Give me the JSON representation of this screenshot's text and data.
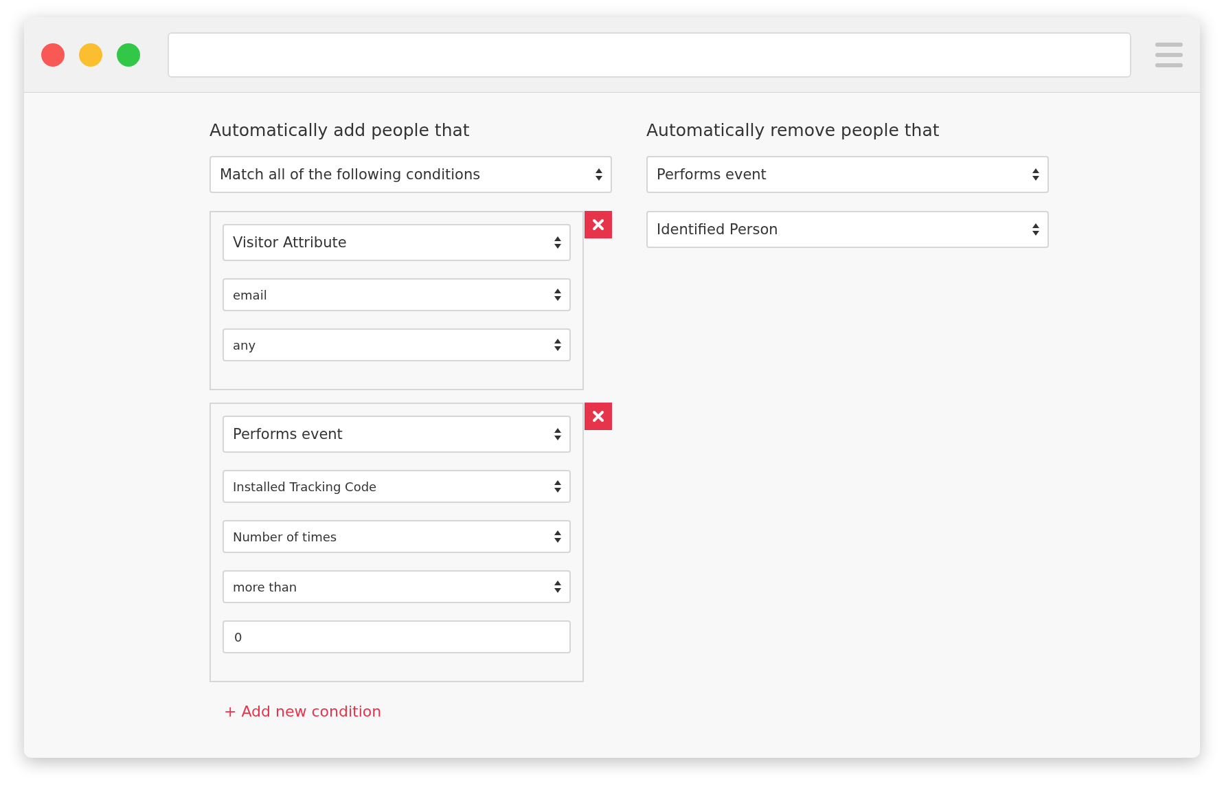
{
  "add_section": {
    "heading": "Automatically add people that",
    "match_select": {
      "value": "Match all of the following conditions"
    },
    "conditions": [
      {
        "fields": [
          {
            "kind": "type-select",
            "value": "Visitor Attribute"
          },
          {
            "kind": "select",
            "value": "email"
          },
          {
            "kind": "select",
            "value": "any"
          }
        ]
      },
      {
        "fields": [
          {
            "kind": "type-select",
            "value": "Performs event"
          },
          {
            "kind": "select",
            "value": "Installed Tracking Code"
          },
          {
            "kind": "select",
            "value": "Number of times"
          },
          {
            "kind": "select",
            "value": "more than"
          },
          {
            "kind": "input",
            "value": "0"
          }
        ]
      }
    ],
    "add_link": "+ Add new condition"
  },
  "remove_section": {
    "heading": "Automatically remove people that",
    "selects": [
      {
        "value": "Performs event"
      },
      {
        "value": "Identified Person"
      }
    ]
  }
}
